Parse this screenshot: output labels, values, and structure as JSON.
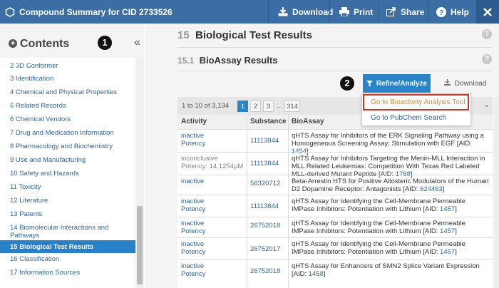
{
  "topbar": {
    "title": "Compound Summary for CID 2733526",
    "download": "Download",
    "print": "Print",
    "share": "Share",
    "help": "Help",
    "bg_color": "#3b6ea5"
  },
  "sidebar": {
    "title": "Contents",
    "callout": "1",
    "items": [
      {
        "label": "2  3D Conformer"
      },
      {
        "label": "3  Identification"
      },
      {
        "label": "4  Chemical and Physical Properties"
      },
      {
        "label": "5  Related Records"
      },
      {
        "label": "6  Chemical Vendors"
      },
      {
        "label": "7  Drug and Medication Information"
      },
      {
        "label": "8  Pharmacology and Biochemistry"
      },
      {
        "label": "9  Use and Manufacturing"
      },
      {
        "label": "10  Safety and Hazards"
      },
      {
        "label": "11  Toxicity"
      },
      {
        "label": "12  Literature"
      },
      {
        "label": "13  Patents"
      },
      {
        "label": "14  Biomolecular Interactions and Pathways"
      },
      {
        "label": "15  Biological Test Results"
      },
      {
        "label": "16  Classification"
      },
      {
        "label": "17  Information Sources"
      }
    ],
    "active_index": 13
  },
  "main": {
    "section_num": "15",
    "section_title": "Biological Test Results",
    "sub_num": "15.1",
    "sub_title": "BioAssay Results",
    "callout": "2",
    "refine_label": "Refine/Analyze",
    "download_label": "Download",
    "dropdown": {
      "item1": "Go to Bioactivity Analysis Tool",
      "item2": "Go to PubChem Search"
    },
    "pager": {
      "count": "1 to 10 of 3,134",
      "pages": [
        "1",
        "2",
        "3",
        "...",
        "314"
      ]
    },
    "table": {
      "headers": [
        "Activity",
        "Substance",
        "BioAssay"
      ],
      "rows": [
        {
          "activity": "inactive\nPotency",
          "substance": "11113844",
          "bioassay": "qHTS Assay for Inhibitors of the ERK Signaling Pathway using a Homogeneous Screening Assay; Stimulation with EGF [AID:",
          "aid": "1454",
          "suffix": "]"
        },
        {
          "activity": "inconclusive\nPotency: 14.1254µM",
          "substance": "11113844",
          "bioassay": "qHTS Assay for Inhibitors Targeting the Menin-MLL Interaction in MLL Related Leukemias: Competition With Texas Red Labeled MLL-derived Mutant Peptide [AID:",
          "aid": "1768",
          "suffix": "]"
        },
        {
          "activity": "inactive",
          "substance": "56320712",
          "bioassay": "Beta-Arrestin HTS for Positive Allosteric Modulators of the Human D2 Dopamine Receptor: Antagonists [AID:",
          "aid": "624463",
          "suffix": "]"
        },
        {
          "activity": "inactive\nPotency",
          "substance": "11113844",
          "bioassay": "qHTS Assay for Identifying the Cell-Membrane Permeable IMPase Inhibitors: Potentiation with Lithium [AID:",
          "aid": "1457",
          "suffix": "]"
        },
        {
          "activity": "inactive\nPotency",
          "substance": "26752018",
          "bioassay": "qHTS Assay for Identifying the Cell-Membrane Permeable IMPase Inhibitors: Potentiation with Lithium [AID:",
          "aid": "1457",
          "suffix": "]"
        },
        {
          "activity": "inactive\nPotency",
          "substance": "26752017",
          "bioassay": "qHTS Assay for Identifying the Cell-Membrane Permeable IMPase Inhibitors: Potentiation with Lithium [AID:",
          "aid": "1457",
          "suffix": "]"
        },
        {
          "activity": "inactive\nPotency",
          "substance": "26752018",
          "bioassay": "qHTS Assay for Enhancers of SMN2 Splice Variant Expression [AID:",
          "aid": "1458",
          "suffix": "]"
        }
      ]
    }
  }
}
